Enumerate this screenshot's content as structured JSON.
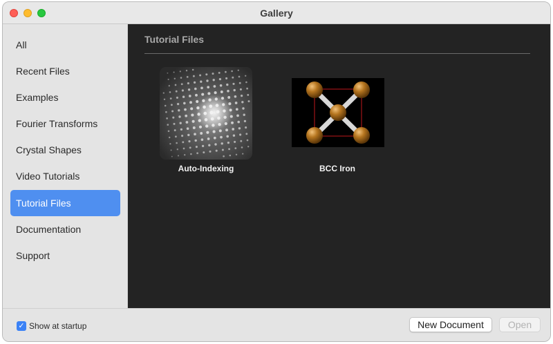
{
  "window": {
    "title": "Gallery"
  },
  "sidebar": {
    "items": [
      {
        "label": "All"
      },
      {
        "label": "Recent Files"
      },
      {
        "label": "Examples"
      },
      {
        "label": "Fourier Transforms"
      },
      {
        "label": "Crystal Shapes"
      },
      {
        "label": "Video Tutorials"
      },
      {
        "label": "Tutorial Files"
      },
      {
        "label": "Documentation"
      },
      {
        "label": "Support"
      }
    ],
    "selected": "Tutorial Files"
  },
  "content": {
    "section_title": "Tutorial Files",
    "items": [
      {
        "label": "Auto-Indexing",
        "icon": "diffraction-pattern-icon"
      },
      {
        "label": "BCC Iron",
        "icon": "bcc-crystal-structure-icon"
      }
    ]
  },
  "footer": {
    "show_at_startup_label": "Show at startup",
    "show_at_startup_checked": true,
    "new_document_label": "New Document",
    "open_label": "Open",
    "open_enabled": false
  },
  "colors": {
    "accent": "#4f8ff0",
    "content_background": "#232323",
    "sidebar_background": "#e4e4e4",
    "atom_color": "#b5751f"
  }
}
